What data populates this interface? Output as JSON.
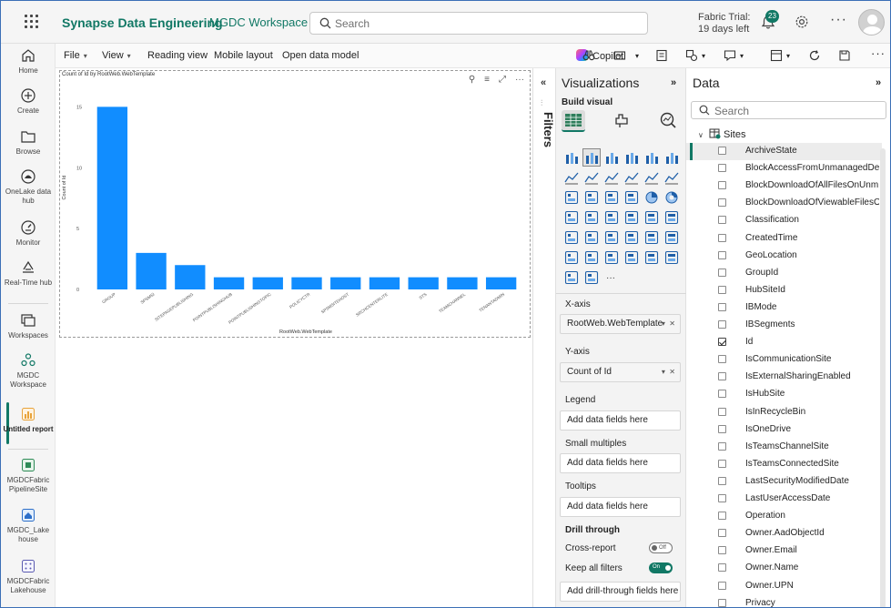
{
  "header": {
    "brand": "Synapse Data Engineering",
    "workspace": "MGDC Workspace",
    "search_placeholder": "Search",
    "trial_line1": "Fabric Trial:",
    "trial_line2": "19 days left",
    "notification_count": "23"
  },
  "nav": {
    "items": [
      {
        "label": "Home",
        "icon": "home-icon"
      },
      {
        "label": "Create",
        "icon": "plus-circle-icon"
      },
      {
        "label": "Browse",
        "icon": "folder-icon"
      },
      {
        "label": "OneLake data hub",
        "icon": "onelake-icon"
      },
      {
        "label": "Monitor",
        "icon": "monitor-icon"
      },
      {
        "label": "Real-Time hub",
        "icon": "realtime-icon"
      },
      {
        "label": "Workspaces",
        "icon": "workspaces-icon"
      },
      {
        "label": "MGDC Workspace",
        "icon": "workspace-icon"
      },
      {
        "label": "Untitled report",
        "icon": "report-icon"
      },
      {
        "label": "MGDCFabric PipelineSite",
        "icon": "pipeline-icon"
      },
      {
        "label": "MGDC_Lake house",
        "icon": "lakehouse-icon"
      },
      {
        "label": "MGDCFabric Lakehouse",
        "icon": "lakehouse-grid-icon"
      }
    ]
  },
  "ribbon": {
    "file": "File",
    "view": "View",
    "reading_view": "Reading view",
    "mobile_layout": "Mobile layout",
    "open_data_model": "Open data model",
    "copilot": "Copilot"
  },
  "chart_data": {
    "type": "bar",
    "title": "Count of Id by RootWeb.WebTemplate",
    "xlabel": "RootWeb.WebTemplate",
    "ylabel": "Count of Id",
    "categories": [
      "GROUP",
      "SPSMSITEHOST",
      "SITEPAGEPUBLISHING",
      "POINTPUBLISHINGHUB",
      "POINTPUBLISHINGTOPIC",
      "POLICYCTR",
      "SPSMSITEHOST",
      "SRCHCENTERLITE",
      "STS",
      "TEAMCHANNEL",
      "TENANTADMIN"
    ],
    "display_categories": [
      "GROUP",
      "SPSMSI",
      "SITEPAGEPUBLISHING",
      "POINTPUBLISHINGHUB",
      "POINTPUBLISHINGTOPIC",
      "POLICYCTR",
      "SPSMSITEHOST",
      "SRCHCENTERLITE",
      "STS",
      "TEAMCHANNEL",
      "TENANTADMIN"
    ],
    "values": [
      15,
      3,
      2,
      1,
      1,
      1,
      1,
      1,
      1,
      1,
      1
    ],
    "yticks": [
      0,
      5,
      10,
      15
    ],
    "ylim": [
      0,
      16
    ],
    "bar_color": "#118dff",
    "grid": false
  },
  "filters": {
    "label": "Filters"
  },
  "viz": {
    "title": "Visualizations",
    "build_visual": "Build visual",
    "xaxis_label": "X-axis",
    "xaxis_field": "RootWeb.WebTemplate",
    "yaxis_label": "Y-axis",
    "yaxis_field": "Count of Id",
    "legend_label": "Legend",
    "legend_placeholder": "Add data fields here",
    "small_multiples_label": "Small multiples",
    "small_multiples_placeholder": "Add data fields here",
    "tooltips_label": "Tooltips",
    "tooltips_placeholder": "Add data fields here",
    "drill_label": "Drill through",
    "cross_report": "Cross-report",
    "cross_report_state": "Off",
    "keep_filters": "Keep all filters",
    "keep_filters_state": "On",
    "drill_placeholder": "Add drill-through fields here"
  },
  "data": {
    "title": "Data",
    "search_placeholder": "Search",
    "table": "Sites",
    "fields": [
      {
        "name": "ArchiveState",
        "checked": false
      },
      {
        "name": "BlockAccessFromUnmanagedDev...",
        "checked": false
      },
      {
        "name": "BlockDownloadOfAllFilesOnUnm...",
        "checked": false
      },
      {
        "name": "BlockDownloadOfViewableFilesO...",
        "checked": false
      },
      {
        "name": "Classification",
        "checked": false
      },
      {
        "name": "CreatedTime",
        "checked": false
      },
      {
        "name": "GeoLocation",
        "checked": false
      },
      {
        "name": "GroupId",
        "checked": false
      },
      {
        "name": "HubSiteId",
        "checked": false
      },
      {
        "name": "IBMode",
        "checked": false
      },
      {
        "name": "IBSegments",
        "checked": false
      },
      {
        "name": "Id",
        "checked": true
      },
      {
        "name": "IsCommunicationSite",
        "checked": false
      },
      {
        "name": "IsExternalSharingEnabled",
        "checked": false
      },
      {
        "name": "IsHubSite",
        "checked": false
      },
      {
        "name": "IsInRecycleBin",
        "checked": false
      },
      {
        "name": "IsOneDrive",
        "checked": false
      },
      {
        "name": "IsTeamsChannelSite",
        "checked": false
      },
      {
        "name": "IsTeamsConnectedSite",
        "checked": false
      },
      {
        "name": "LastSecurityModifiedDate",
        "checked": false
      },
      {
        "name": "LastUserAccessDate",
        "checked": false
      },
      {
        "name": "Operation",
        "checked": false
      },
      {
        "name": "Owner.AadObjectId",
        "checked": false
      },
      {
        "name": "Owner.Email",
        "checked": false
      },
      {
        "name": "Owner.Name",
        "checked": false
      },
      {
        "name": "Owner.UPN",
        "checked": false
      },
      {
        "name": "Privacy",
        "checked": false
      }
    ]
  }
}
